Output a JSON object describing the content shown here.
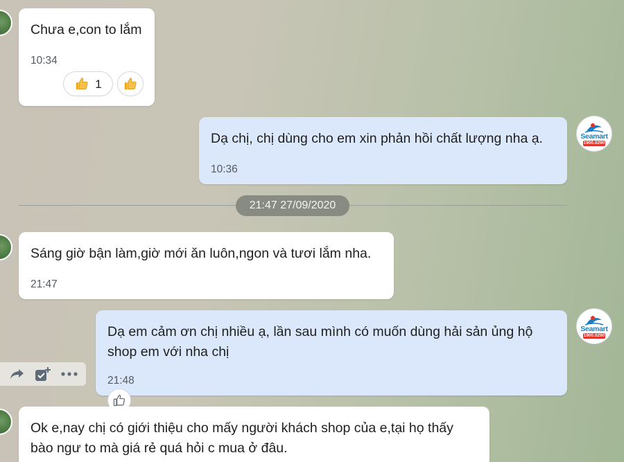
{
  "messages": [
    {
      "text": "Chưa e,con to lắm",
      "time": "10:34"
    },
    {
      "text": "Dạ chị, chị dùng cho em xin phản hồi chất lượng nha ạ.",
      "time": "10:36"
    },
    {
      "text": "Sáng giờ bận làm,giờ mới ăn luôn,ngon và tươi lắm nha.",
      "time": "21:47"
    },
    {
      "text": "Dạ em cảm ơn chị nhiều ạ, lần sau mình có muốn dùng hải sản ủng hộ shop em với nha chị",
      "time": "21:48"
    },
    {
      "text": "Ok e,nay chị có giới thiệu cho mấy người khách shop của e,tại họ thấy bào ngư to mà giá rẻ quá hỏi c mua ở đâu.",
      "time": ""
    }
  ],
  "reactions": {
    "like_count": "1",
    "icon": "thumbs-up-icon"
  },
  "date_separator": "21:47 27/09/2020",
  "shop_avatar": {
    "name": "Seamart",
    "phone": "1900.0290"
  },
  "hover_actions": {
    "icons": [
      "share-icon",
      "task-icon",
      "more-icon"
    ]
  },
  "colors": {
    "incoming_bubble": "#ffffff",
    "outgoing_bubble": "#dbe7fb",
    "date_pill": "#878b81",
    "seamart_blue": "#1b7fc1",
    "seamart_red": "#e2332b"
  }
}
